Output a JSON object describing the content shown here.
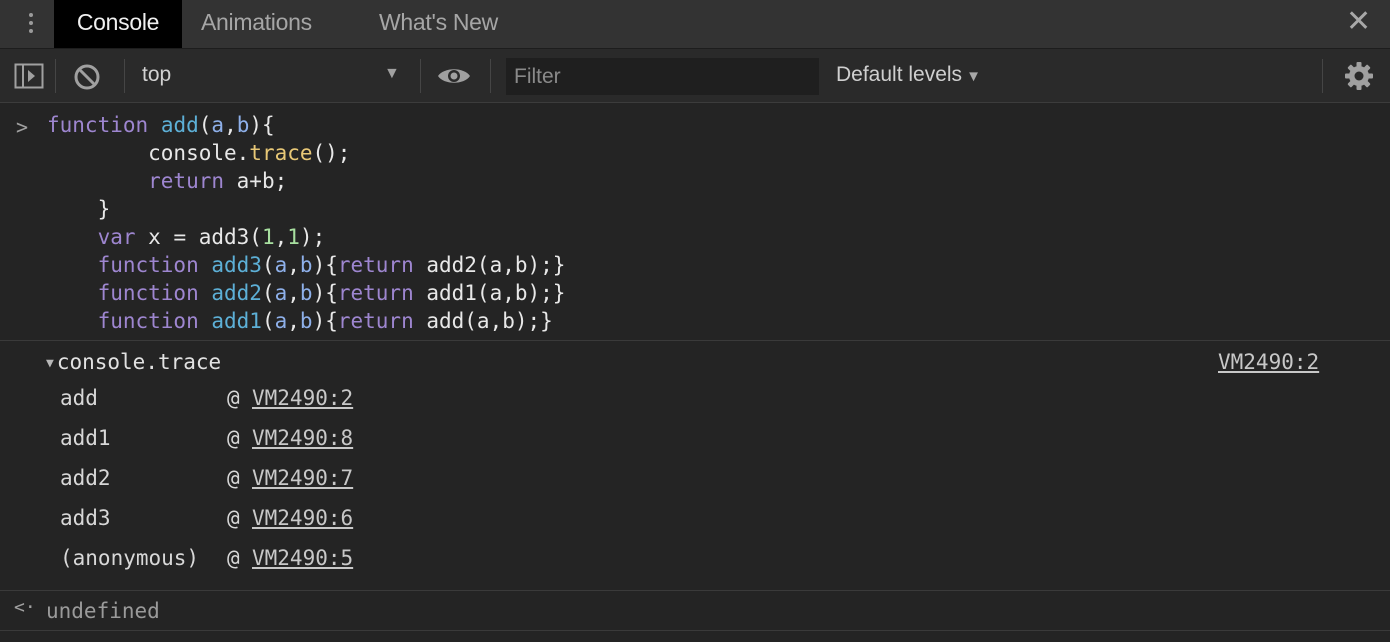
{
  "tabs": [
    "Console",
    "Animations",
    "What's New"
  ],
  "toolbar": {
    "context": "top",
    "filter_placeholder": "Filter",
    "levels": "Default levels"
  },
  "code": {
    "prompt": ">",
    "line1": {
      "kw": "function",
      "name": "add",
      "p1": "(",
      "a": "a",
      "comma": ",",
      "b": "b",
      "p2": "){"
    },
    "line2": {
      "obj": "        console.",
      "method": "trace",
      "end": "();"
    },
    "line3": {
      "kw": "        return",
      "expr": " a+b;"
    },
    "line4": "    }",
    "line5": {
      "kw": "    var",
      "mid": " x = add3(",
      "n1": "1",
      "comma": ",",
      "n2": "1",
      "end": ");"
    },
    "line6": {
      "kw": "    function",
      "name": " add3",
      "p1": "(",
      "a": "a",
      "comma": ",",
      "b": "b",
      "p2": "){",
      "ret": "return",
      "tail": " add2(a,b);}"
    },
    "line7": {
      "kw": "    function",
      "name": " add2",
      "p1": "(",
      "a": "a",
      "comma": ",",
      "b": "b",
      "p2": "){",
      "ret": "return",
      "tail": " add1(a,b);}"
    },
    "line8": {
      "kw": "    function",
      "name": " add1",
      "p1": "(",
      "a": "a",
      "comma": ",",
      "b": "b",
      "p2": "){",
      "ret": "return",
      "tail": " add(a,b);}"
    }
  },
  "trace": {
    "title": "console.trace",
    "source": "VM2490:2",
    "frames": [
      {
        "fn": "add",
        "at": "@",
        "loc": "VM2490:2"
      },
      {
        "fn": "add1",
        "at": "@",
        "loc": "VM2490:8"
      },
      {
        "fn": "add2",
        "at": "@",
        "loc": "VM2490:7"
      },
      {
        "fn": "add3",
        "at": "@",
        "loc": "VM2490:6"
      },
      {
        "fn": "(anonymous)",
        "at": "@",
        "loc": "VM2490:5"
      }
    ]
  },
  "result": {
    "arrow": "<·",
    "value": "undefined"
  },
  "icons": {
    "menu": "kebab-menu-icon",
    "close": "close-icon",
    "sidebar": "show-sidebar-icon",
    "clear": "clear-console-icon",
    "eye": "live-expression-eye-icon",
    "gear": "settings-gear-icon"
  },
  "colors": {
    "keyword": "#9e86d0",
    "function_name": "#5db0d7",
    "number": "#a8e0a0",
    "method": "#e8c877",
    "background": "#242424"
  }
}
